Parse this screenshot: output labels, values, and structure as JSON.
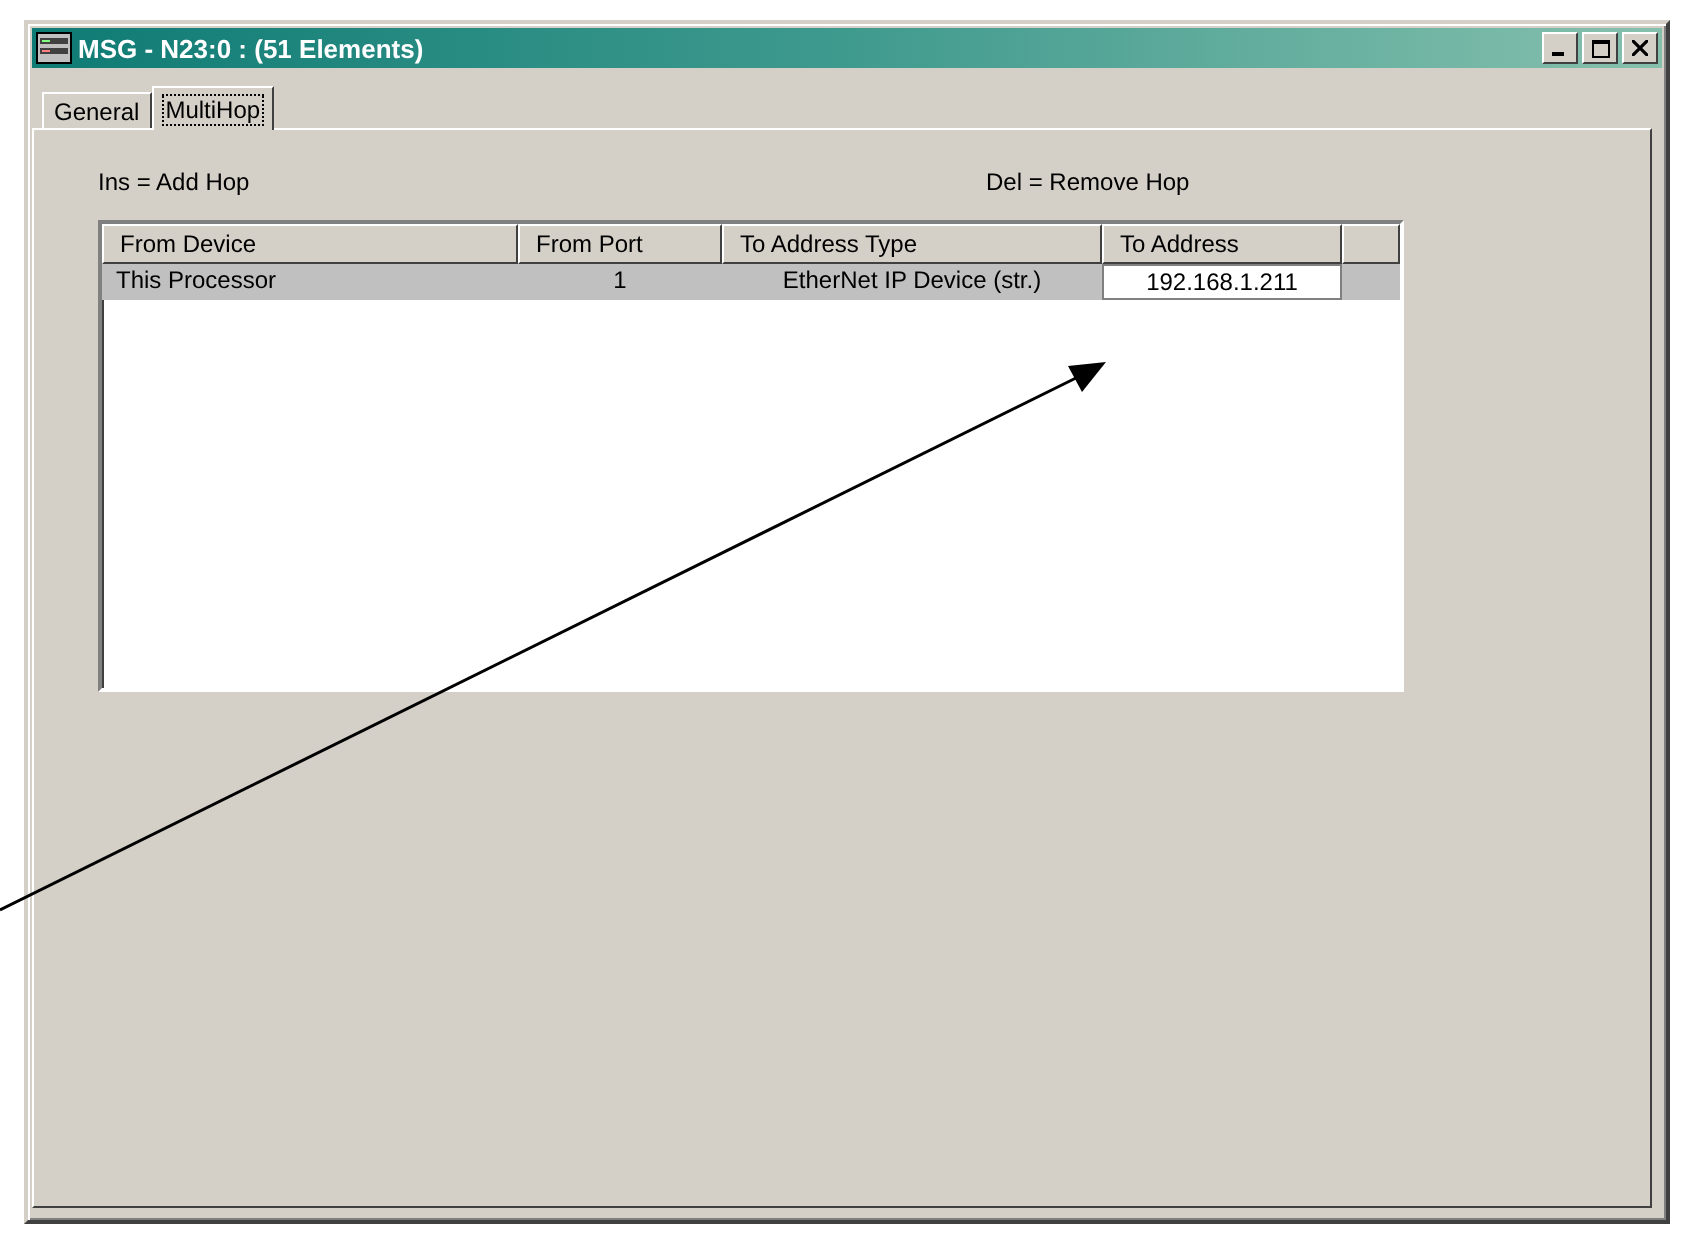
{
  "window": {
    "title": "MSG - N23:0 : (51 Elements)"
  },
  "tabs": [
    {
      "label": "General",
      "selected": false
    },
    {
      "label": "MultiHop",
      "selected": true
    }
  ],
  "hints": {
    "insert": "Ins = Add Hop",
    "delete": "Del = Remove Hop"
  },
  "table": {
    "columns": [
      "From Device",
      "From Port",
      "To Address Type",
      "To Address"
    ],
    "rows": [
      {
        "from_device": "This Processor",
        "from_port": "1",
        "to_address_type": "EtherNet IP Device (str.)",
        "to_address": "192.168.1.211",
        "selected": true
      }
    ]
  }
}
